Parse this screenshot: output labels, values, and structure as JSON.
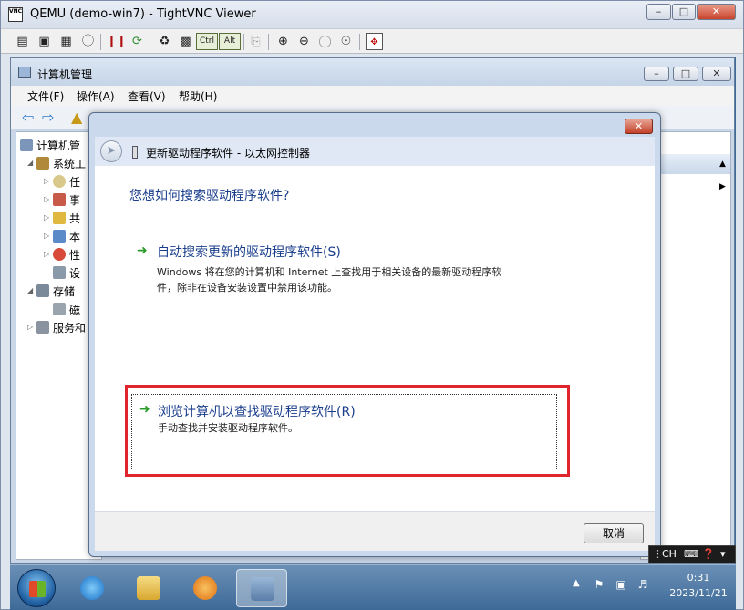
{
  "vnc": {
    "title": "QEMU (demo-win7) - TightVNC Viewer",
    "ctrl_label": "Ctrl",
    "alt_label": "Alt"
  },
  "computer_management": {
    "title": "计算机管理",
    "menu": [
      "文件(F)",
      "操作(A)",
      "查看(V)",
      "帮助(H)"
    ],
    "tree": {
      "root": "计算机管",
      "system_tools": "系统工",
      "item_task": "任",
      "item_event": "事",
      "item_shared": "共",
      "item_local": "本",
      "item_perf": "性",
      "item_device": "设",
      "storage": "存储",
      "disk": "磁",
      "services": "服务和"
    }
  },
  "dialog": {
    "header": "更新驱动程序软件 - 以太网控制器",
    "question": "您想如何搜索驱动程序软件?",
    "option1": {
      "title": "自动搜索更新的驱动程序软件(S)",
      "description_line1": "Windows 将在您的计算机和 Internet 上查找用于相关设备的最新驱动程序软",
      "description_line2": "件，除非在设备安装设置中禁用该功能。"
    },
    "option2": {
      "title": "浏览计算机以查找驱动程序软件(R)",
      "description": "手动查找并安装驱动程序软件。"
    },
    "cancel_label": "取消"
  },
  "language_bar": {
    "language": "CH"
  },
  "taskbar": {
    "clock_time": "0:31",
    "clock_date": "2023/11/21"
  },
  "colors": {
    "highlight_border": "#e0242e",
    "link_blue": "#1a3e8c",
    "arrow_green": "#2a9a2a"
  }
}
